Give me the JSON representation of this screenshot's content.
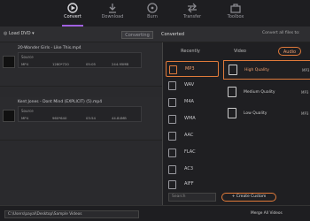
{
  "toolbar": {
    "convert": "Convert",
    "download": "Download",
    "burn": "Burn",
    "transfer": "Transfer",
    "toolbox": "Toolbox"
  },
  "subbar": {
    "load_dvd": "Load DVD",
    "converting": "Converting",
    "converted": "Converted",
    "convert_all": "Convert all files to:"
  },
  "files": [
    {
      "title": "20-Wonder Girls - Like This.mp4",
      "source_label": "Source",
      "format": "MP4",
      "resolution": "1280*720",
      "duration": "05:05",
      "size": "244.95MB"
    },
    {
      "title": "Kent Jones - Dont Mind (EXPLICIT) (5).mp4",
      "source_label": "Source",
      "format": "MP4",
      "resolution": "960*640",
      "duration": "03:54",
      "size": "44.84MB"
    }
  ],
  "panel": {
    "tabs": [
      "Recently",
      "Video",
      "Audio"
    ],
    "formats": [
      "MP3",
      "WAV",
      "M4A",
      "WMA",
      "AAC",
      "FLAC",
      "AC3",
      "AIFF"
    ],
    "qualities": [
      {
        "name": "High Quality",
        "fmt": "MP3"
      },
      {
        "name": "Medium Quality",
        "fmt": "MP3"
      },
      {
        "name": "Low Quality",
        "fmt": "MP3"
      }
    ],
    "search_placeholder": "Search",
    "create_custom": "+ Create Custom"
  },
  "bottom": {
    "output_path": "C:\\Users\\payal\\Desktop\\Sample Videos",
    "merge_label": "Merge All Videos"
  },
  "colors": {
    "accent": "#e07a3a",
    "active_tab": "#a060e0"
  }
}
